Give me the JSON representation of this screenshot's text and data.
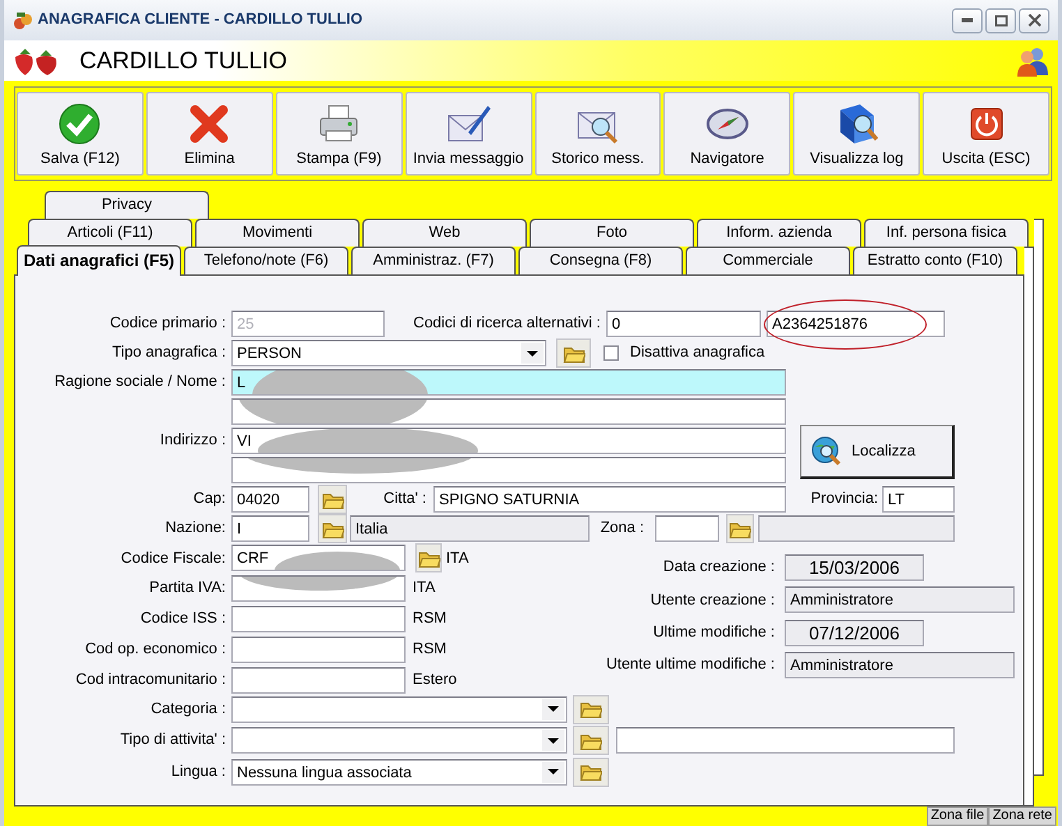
{
  "window": {
    "title": "ANAGRAFICA CLIENTE - CARDILLO TULLIO"
  },
  "header": {
    "name": "CARDILLO TULLIO"
  },
  "toolbar": [
    {
      "label": "Salva (F12)",
      "kind": "save"
    },
    {
      "label": "Elimina",
      "kind": "delete"
    },
    {
      "label": "Stampa (F9)",
      "kind": "print"
    },
    {
      "label": "Invia messaggio",
      "kind": "send"
    },
    {
      "label": "Storico mess.",
      "kind": "history"
    },
    {
      "label": "Navigatore",
      "kind": "navigator"
    },
    {
      "label": "Visualizza log",
      "kind": "log"
    },
    {
      "label": "Uscita (ESC)",
      "kind": "exit"
    }
  ],
  "tab_rows": [
    {
      "tabs": [
        {
          "label": "Privacy",
          "selected": false
        }
      ]
    },
    {
      "tabs": [
        {
          "label": "Articoli (F11)",
          "selected": false
        },
        {
          "label": "Movimenti",
          "selected": false
        },
        {
          "label": "Web",
          "selected": false
        },
        {
          "label": "Foto",
          "selected": false
        },
        {
          "label": "Inform. azienda",
          "selected": false
        },
        {
          "label": "Inf. persona fisica",
          "selected": false
        }
      ]
    },
    {
      "tabs": [
        {
          "label": "Dati anagrafici (F5)",
          "selected": true
        },
        {
          "label": "Telefono/note (F6)",
          "selected": false
        },
        {
          "label": "Amministraz. (F7)",
          "selected": false
        },
        {
          "label": "Consegna (F8)",
          "selected": false
        },
        {
          "label": "Commerciale",
          "selected": false
        },
        {
          "label": "Estratto conto (F10)",
          "selected": false
        }
      ]
    }
  ],
  "form": {
    "top_rows": [
      [
        {
          "kind": "label",
          "text": "Codice primario :"
        },
        {
          "kind": "field",
          "disabled": true,
          "value": "25"
        },
        {
          "kind": "label",
          "text": "Codici di ricerca alternativi :"
        },
        {
          "kind": "field",
          "value": "0"
        },
        {
          "kind": "field",
          "value": "A2364251876",
          "circled": true
        }
      ],
      [
        {
          "kind": "label",
          "text": "Tipo anagrafica :"
        },
        {
          "kind": "combo",
          "value": "PERSON"
        },
        {
          "kind": "folder"
        },
        {
          "kind": "checkbox",
          "label": "Disattiva anagrafica",
          "checked": false
        }
      ],
      [
        {
          "kind": "label",
          "text": "Ragione sociale / Nome :"
        },
        {
          "kind": "field",
          "highlighted": true,
          "value": "L",
          "redacted": true
        }
      ],
      [
        {
          "kind": "field",
          "redacted": true
        }
      ],
      [
        {
          "kind": "label",
          "text": "Indirizzo :"
        },
        {
          "kind": "field",
          "value": "VI",
          "redacted": true
        },
        {
          "kind": "button",
          "label": "Localizza"
        }
      ],
      [
        {
          "kind": "field",
          "redacted": true
        }
      ],
      [
        {
          "kind": "label",
          "text": "Cap:"
        },
        {
          "kind": "field",
          "value": "04020"
        },
        {
          "kind": "folder"
        },
        {
          "kind": "label",
          "text": "Citta' :"
        },
        {
          "kind": "field",
          "value": "SPIGNO SATURNIA"
        },
        {
          "kind": "label",
          "text": "Provincia:"
        },
        {
          "kind": "field",
          "value": "LT"
        }
      ],
      [
        {
          "kind": "label",
          "text": "Nazione:"
        },
        {
          "kind": "field",
          "value": "I"
        },
        {
          "kind": "folder"
        },
        {
          "kind": "field",
          "readonly": true,
          "value": "Italia"
        },
        {
          "kind": "label",
          "text": "Zona :"
        },
        {
          "kind": "field"
        },
        {
          "kind": "folder"
        },
        {
          "kind": "field",
          "readonly": true
        }
      ]
    ],
    "left_rows": [
      [
        {
          "kind": "label",
          "text": "Codice Fiscale:"
        },
        {
          "kind": "field",
          "value": "CRF",
          "redacted": true
        },
        {
          "kind": "folder"
        },
        {
          "kind": "text",
          "text": "ITA"
        }
      ],
      [
        {
          "kind": "label",
          "text": "Partita IVA:"
        },
        {
          "kind": "field",
          "redacted": true
        },
        {
          "kind": "text",
          "text": "ITA"
        }
      ],
      [
        {
          "kind": "label",
          "text": "Codice ISS :"
        },
        {
          "kind": "field"
        },
        {
          "kind": "text",
          "text": "RSM"
        }
      ],
      [
        {
          "kind": "label",
          "text": "Cod op. economico :"
        },
        {
          "kind": "field"
        },
        {
          "kind": "text",
          "text": "RSM"
        }
      ],
      [
        {
          "kind": "label",
          "text": "Cod intracomunitario :"
        },
        {
          "kind": "field"
        },
        {
          "kind": "text",
          "text": "Estero"
        }
      ]
    ],
    "right_rows": [
      [
        {
          "kind": "label",
          "text": "Data creazione :"
        },
        {
          "kind": "date",
          "value": "15/03/2006"
        }
      ],
      [
        {
          "kind": "label",
          "text": "Utente creazione :"
        },
        {
          "kind": "field",
          "readonly": true,
          "value": "Amministratore"
        }
      ],
      [
        {
          "kind": "label",
          "text": "Ultime modifiche :"
        },
        {
          "kind": "date",
          "value": "07/12/2006"
        }
      ],
      [
        {
          "kind": "label",
          "text": "Utente ultime modifiche :"
        },
        {
          "kind": "field",
          "readonly": true,
          "value": "Amministratore"
        }
      ]
    ],
    "bottom_rows": [
      [
        {
          "kind": "label",
          "text": "Categoria :"
        },
        {
          "kind": "combo"
        },
        {
          "kind": "folder"
        }
      ],
      [
        {
          "kind": "label",
          "text": "Tipo di attivita' :"
        },
        {
          "kind": "combo"
        },
        {
          "kind": "folder"
        },
        {
          "kind": "field"
        }
      ],
      [
        {
          "kind": "label",
          "text": "Lingua :"
        },
        {
          "kind": "combo",
          "value": "Nessuna lingua associata"
        },
        {
          "kind": "folder"
        }
      ]
    ]
  },
  "status_bar": [
    {
      "label": "Zona file"
    },
    {
      "label": "Zona rete"
    }
  ]
}
